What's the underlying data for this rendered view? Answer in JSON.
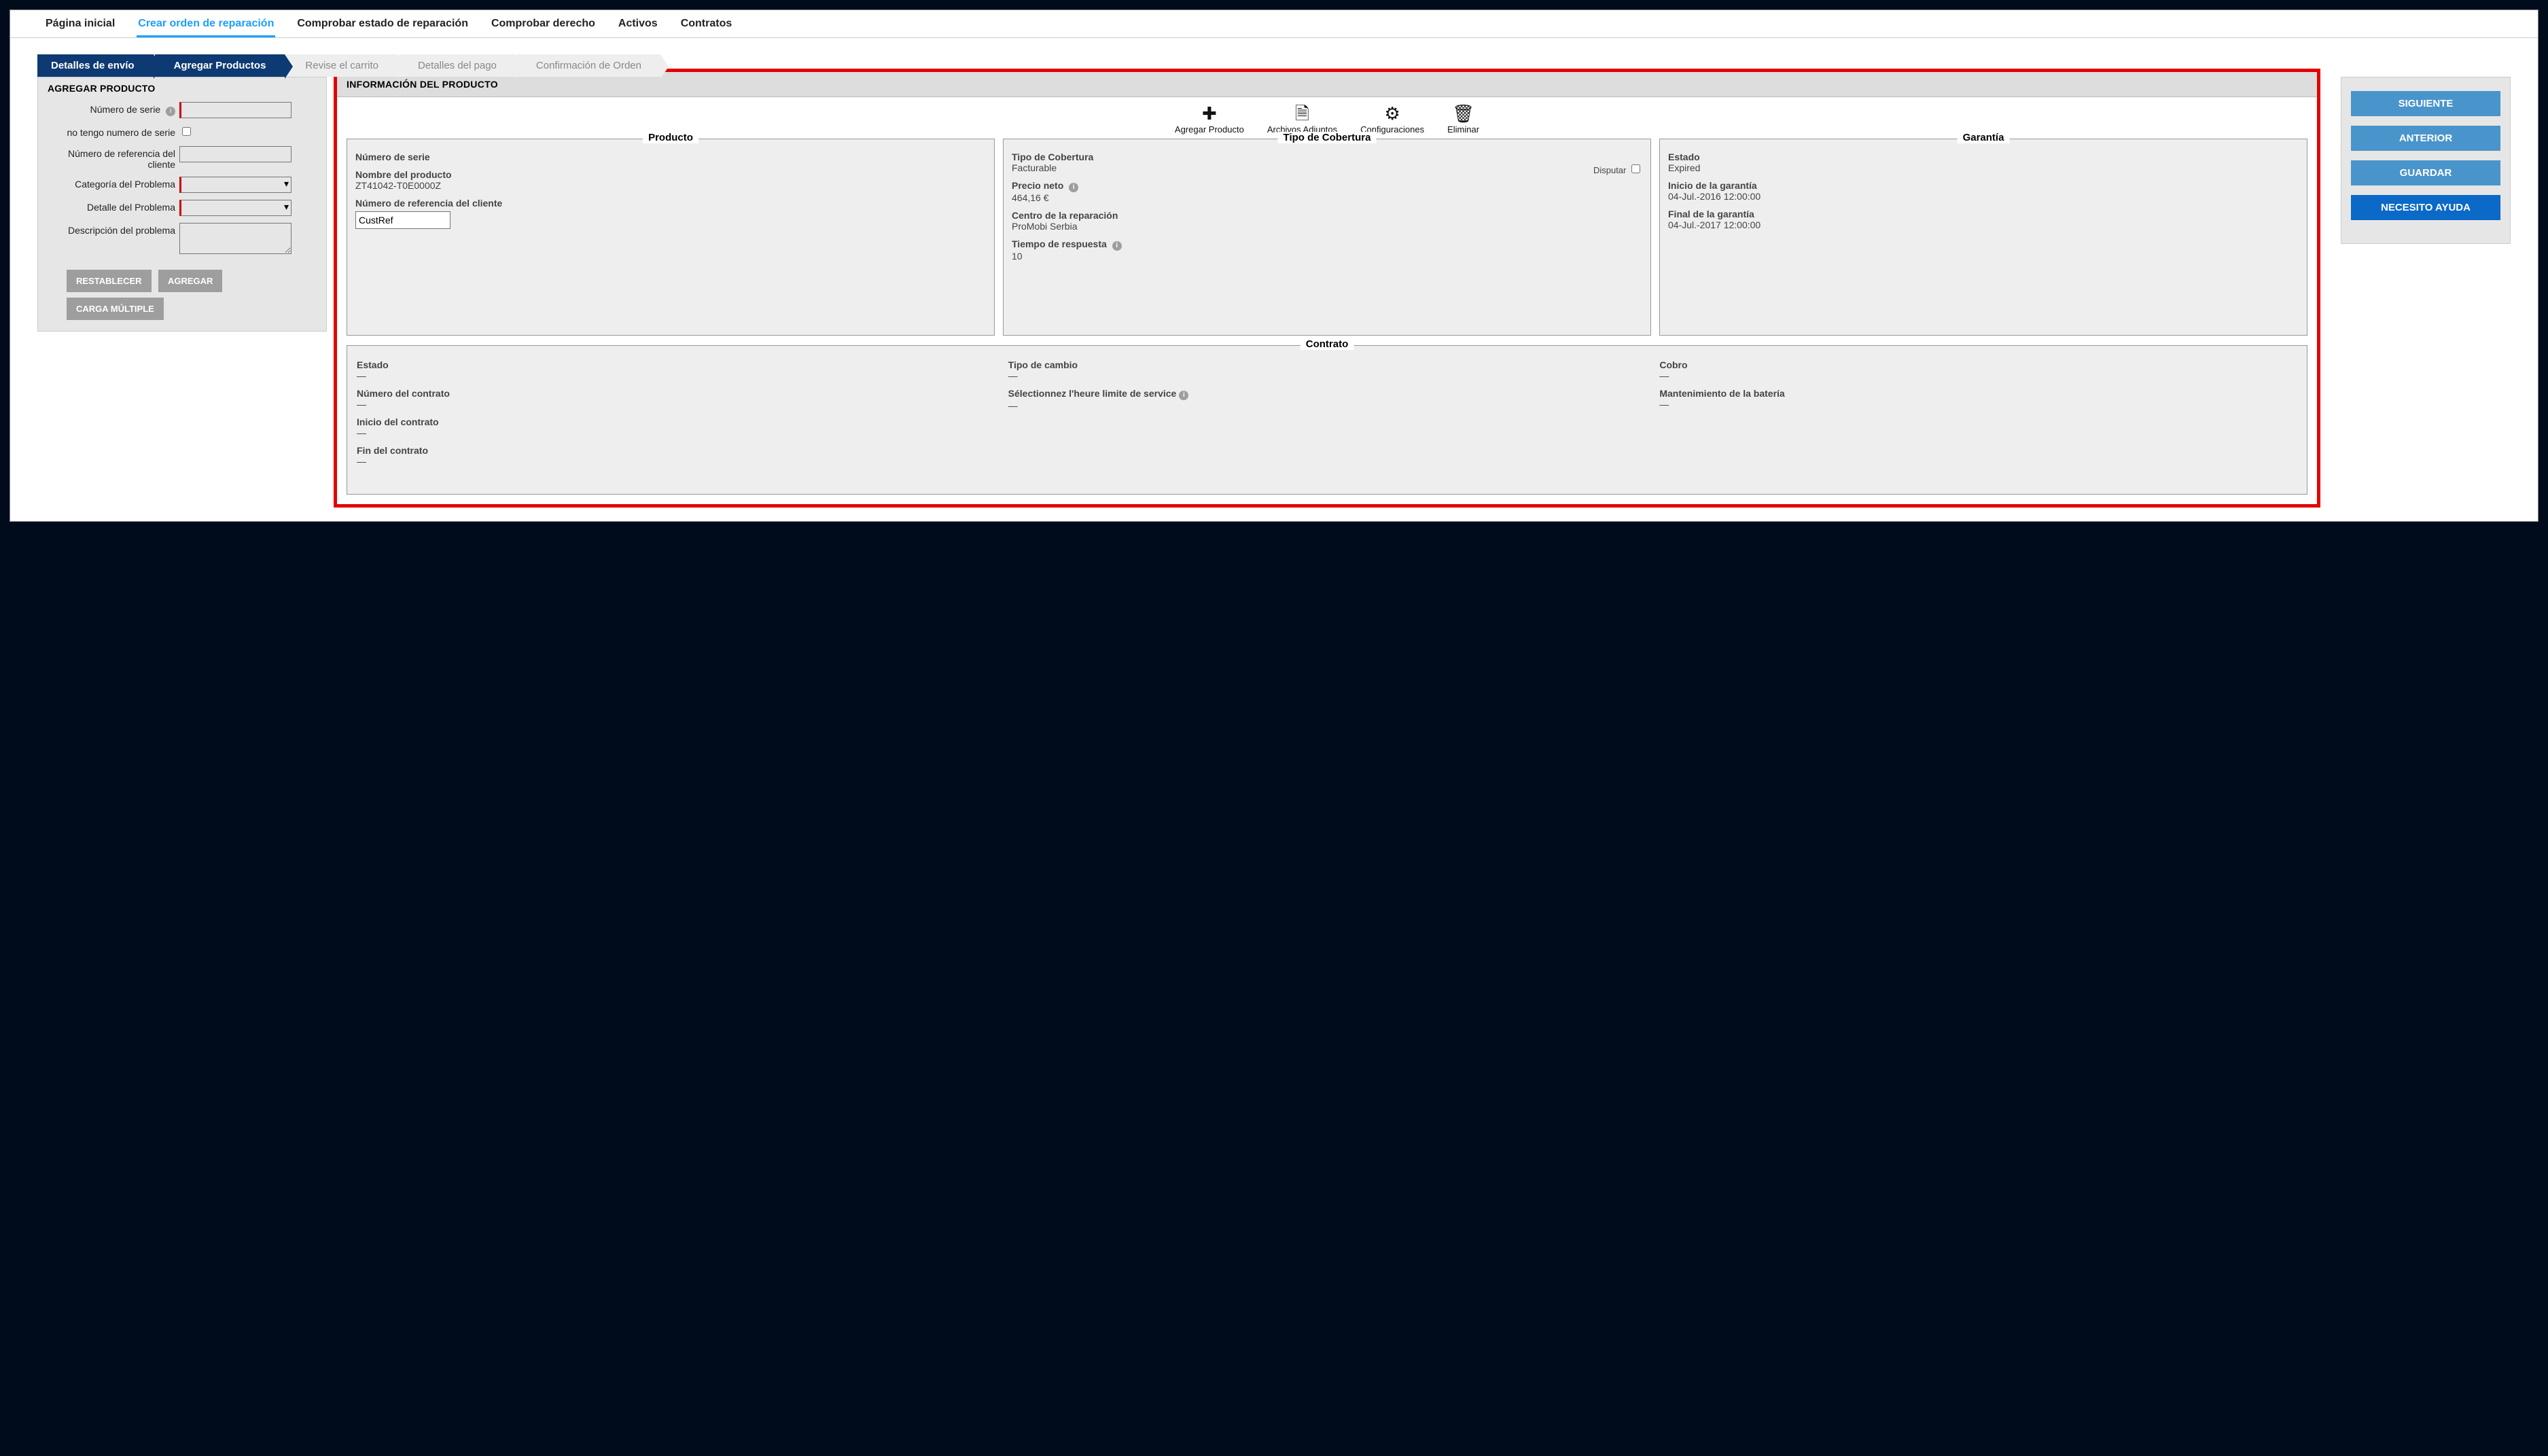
{
  "tabs": {
    "home": "Página inicial",
    "create": "Crear orden de reparación",
    "check_status": "Comprobar estado de reparación",
    "check_right": "Comprobar derecho",
    "assets": "Activos",
    "contracts": "Contratos"
  },
  "crumbs": {
    "c1": "Detalles de envío",
    "c2": "Agregar Productos",
    "c3": "Revise el carrito",
    "c4": "Detalles del pago",
    "c5": "Confirmación de Orden"
  },
  "addform": {
    "title": "AGREGAR PRODUCTO",
    "serial_label": "Número de serie",
    "noserial_label": "no tengo numero de serie",
    "custref_label": "Número de referencia del cliente",
    "cat_label": "Categoría del Problema",
    "detail_label": "Detalle del Problema",
    "desc_label": "Descripción del problema",
    "reset_btn": "RESTABLECER",
    "add_btn": "AGREGAR",
    "multi_btn": "CARGA MÚLTIPLE"
  },
  "info": {
    "header": "INFORMACIÓN DEL PRODUCTO",
    "toolbar": {
      "add": "Agregar Producto",
      "attach": "Archivos Adjuntos",
      "config": "Configuraciones",
      "delete": "Eliminar"
    },
    "producto": {
      "title": "Producto",
      "serial_label": "Número de serie",
      "name_label": "Nombre del producto",
      "name_value": "ZT41042-T0E0000Z",
      "custref_label": "Número de referencia del cliente",
      "custref_value": "CustRef"
    },
    "coverage": {
      "title": "Tipo de Cobertura",
      "type_label": "Tipo de Cobertura",
      "type_value": "Facturable",
      "dispute_label": "Disputar",
      "price_label": "Precio neto",
      "price_value": "464,16 €",
      "center_label": "Centro de la reparación",
      "center_value": "ProMobi Serbia",
      "time_label": "Tiempo de respuesta",
      "time_value": "10"
    },
    "warranty": {
      "title": "Garantía",
      "status_label": "Estado",
      "status_value": "Expired",
      "start_label": "Inicio de la garantía",
      "start_value": "04-Jul.-2016 12:00:00",
      "end_label": "Final de la garantía",
      "end_value": "04-Jul.-2017 12:00:00"
    },
    "contract": {
      "title": "Contrato",
      "status_label": "Estado",
      "status_value": "—",
      "num_label": "Número del contrato",
      "num_value": "—",
      "start_label": "Inicio del contrato",
      "start_value": "—",
      "end_label": "Fin del contrato",
      "end_value": "—",
      "exchange_label": "Tipo de cambio",
      "exchange_value": "—",
      "limit_label": "Sélectionnez l'heure limite de service",
      "limit_value": "—",
      "charge_label": "Cobro",
      "charge_value": "—",
      "battery_label": "Mantenimiento de la batería",
      "battery_value": "—"
    }
  },
  "rightbtns": {
    "next": "SIGUIENTE",
    "prev": "ANTERIOR",
    "save": "GUARDAR",
    "help": "NECESITO AYUDA"
  }
}
